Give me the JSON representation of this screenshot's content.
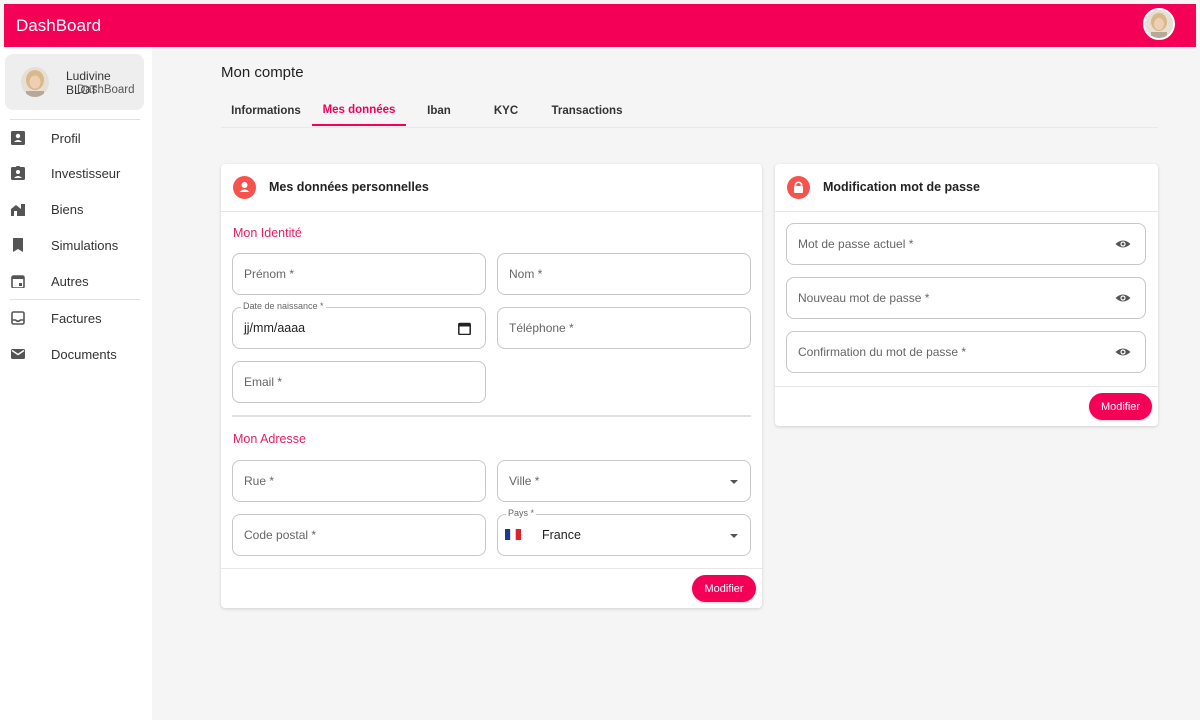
{
  "app": {
    "brand": "DashBoard"
  },
  "user": {
    "name": "Ludivine BLOT",
    "role": "DashBoard"
  },
  "sidebar": {
    "items": [
      {
        "label": "Profil",
        "icon": "account-box-icon"
      },
      {
        "label": "Investisseur",
        "icon": "assignment-ind-icon"
      },
      {
        "label": "Biens",
        "icon": "house-icon"
      },
      {
        "label": "Simulations",
        "icon": "bookmark-icon"
      },
      {
        "label": "Autres",
        "icon": "calendar-icon"
      },
      {
        "label": "Factures",
        "icon": "inbox-icon"
      },
      {
        "label": "Documents",
        "icon": "mail-icon"
      }
    ]
  },
  "page": {
    "title": "Mon compte",
    "tabs": [
      "Informations",
      "Mes données",
      "Iban",
      "KYC",
      "Transactions"
    ],
    "active_tab": "Mes données"
  },
  "personal": {
    "header": "Mes données personnelles",
    "identity_title": "Mon Identité",
    "firstname_label": "Prénom *",
    "lastname_label": "Nom *",
    "birthdate_label": "Date de naissance *",
    "birthdate_value": "jj/mm/aaaa",
    "phone_label": "Téléphone *",
    "email_label": "Email *",
    "address_title": "Mon Adresse",
    "street_label": "Rue *",
    "city_label": "Ville *",
    "postal_label": "Code postal *",
    "country_label": "Pays *",
    "country_value": "France",
    "submit": "Modifier"
  },
  "password": {
    "header": "Modification mot de passe",
    "current_label": "Mot de passe actuel *",
    "new_label": "Nouveau mot de passe *",
    "confirm_label": "Confirmation du mot de passe *",
    "submit": "Modifier"
  },
  "colors": {
    "primary": "#f50057",
    "accent_icon": "#f5544e",
    "section_title": "#e91e63"
  }
}
